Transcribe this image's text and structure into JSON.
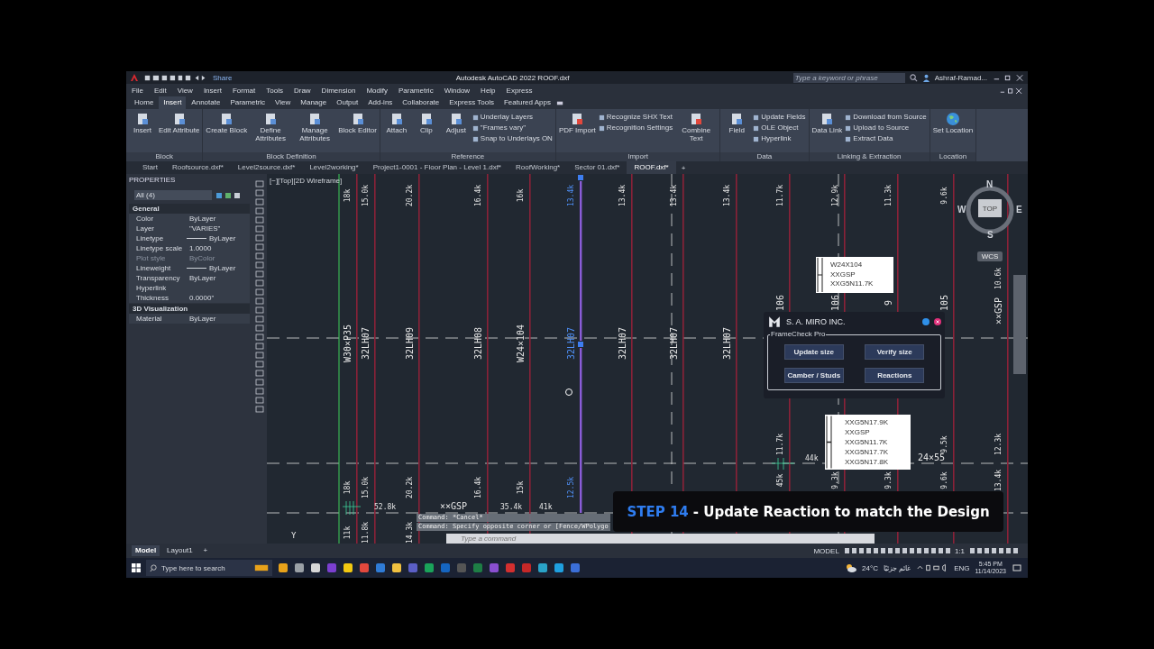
{
  "title_bar": {
    "share": "Share",
    "title": "Autodesk AutoCAD 2022   ROOF.dxf",
    "search": {
      "placeholder": "Type a keyword or phrase"
    },
    "user": "Ashraf-Ramad..."
  },
  "menu": [
    "File",
    "Edit",
    "View",
    "Insert",
    "Format",
    "Tools",
    "Draw",
    "Dimension",
    "Modify",
    "Parametric",
    "Window",
    "Help",
    "Express"
  ],
  "ribbon_tabs": [
    {
      "label": "Home",
      "selected": false
    },
    {
      "label": "Insert",
      "selected": true
    },
    {
      "label": "Annotate",
      "selected": false
    },
    {
      "label": "Parametric",
      "selected": false
    },
    {
      "label": "View",
      "selected": false
    },
    {
      "label": "Manage",
      "selected": false
    },
    {
      "label": "Output",
      "selected": false
    },
    {
      "label": "Add-ins",
      "selected": false
    },
    {
      "label": "Collaborate",
      "selected": false
    },
    {
      "label": "Express Tools",
      "selected": false
    },
    {
      "label": "Featured Apps",
      "selected": false
    }
  ],
  "ribbon_panels": [
    {
      "title": "Block",
      "items": [
        {
          "kind": "large",
          "label": "Insert"
        },
        {
          "kind": "large",
          "label": "Edit Attribute"
        }
      ]
    },
    {
      "title": "Block Definition",
      "items": [
        {
          "kind": "large",
          "label": "Create Block"
        },
        {
          "kind": "large",
          "label": "Define Attributes"
        },
        {
          "kind": "large",
          "label": "Manage Attributes"
        },
        {
          "kind": "large",
          "label": "Block Editor"
        }
      ]
    },
    {
      "title": "Reference",
      "items": [
        {
          "kind": "large",
          "label": "Attach"
        },
        {
          "kind": "large",
          "label": "Clip"
        },
        {
          "kind": "large",
          "label": "Adjust"
        },
        {
          "kind": "stack",
          "labels": [
            "Underlay Layers",
            "\"Frames vary\"",
            "Snap to Underlays ON"
          ]
        }
      ]
    },
    {
      "title": "Import",
      "items": [
        {
          "kind": "large",
          "label": "PDF Import"
        },
        {
          "kind": "stack",
          "labels": [
            "Recognize SHX Text",
            "Recognition Settings"
          ]
        },
        {
          "kind": "large",
          "label": "Combine Text"
        }
      ]
    },
    {
      "title": "Data",
      "items": [
        {
          "kind": "large",
          "label": "Field"
        },
        {
          "kind": "stack",
          "labels": [
            "Update Fields",
            "OLE Object",
            "Hyperlink"
          ]
        }
      ]
    },
    {
      "title": "Linking & Extraction",
      "items": [
        {
          "kind": "large",
          "label": "Data Link"
        },
        {
          "kind": "stack",
          "labels": [
            "Download from Source",
            "Upload to Source",
            "Extract  Data"
          ]
        }
      ]
    },
    {
      "title": "Location",
      "items": [
        {
          "kind": "large",
          "label": "Set Location"
        }
      ]
    }
  ],
  "doc_tabs": [
    {
      "label": "Start",
      "selected": false
    },
    {
      "label": "Roofsource.dxf*",
      "selected": false
    },
    {
      "label": "Level2source.dxf*",
      "selected": false
    },
    {
      "label": "Level2working*",
      "selected": false
    },
    {
      "label": "Project1-0001 - Floor Plan - Level 1.dxf*",
      "selected": false
    },
    {
      "label": "RoofWorking*",
      "selected": false
    },
    {
      "label": "Sector 01.dxf*",
      "selected": false
    },
    {
      "label": "ROOF.dxf*",
      "selected": true
    }
  ],
  "new_tab": "+",
  "properties": {
    "title": "PROPERTIES",
    "selection": "All (4)",
    "sections": [
      {
        "title": "General",
        "rows": [
          {
            "name": "Color",
            "value": "ByLayer",
            "kind": "text",
            "disabled": false
          },
          {
            "name": "Layer",
            "value": "\"VARIES\"",
            "kind": "text",
            "disabled": false
          },
          {
            "name": "Linetype",
            "value": "ByLayer",
            "kind": "line",
            "disabled": false
          },
          {
            "name": "Linetype scale",
            "value": "1.0000",
            "kind": "text",
            "disabled": false
          },
          {
            "name": "Plot style",
            "value": "ByColor",
            "kind": "text",
            "disabled": true
          },
          {
            "name": "Lineweight",
            "value": "ByLayer",
            "kind": "line",
            "disabled": false
          },
          {
            "name": "Transparency",
            "value": "ByLayer",
            "kind": "text",
            "disabled": false
          },
          {
            "name": "Hyperlink",
            "kind": "text",
            "disabled": false
          },
          {
            "name": "Thickness",
            "value": "0.0000\"",
            "kind": "text",
            "disabled": false
          }
        ]
      },
      {
        "title": "3D Visualization",
        "rows": [
          {
            "name": "Material",
            "value": "ByLayer",
            "kind": "text",
            "disabled": false
          }
        ]
      }
    ]
  },
  "drawing": {
    "viewport_label": "[−][Top][2D Wireframe]",
    "members": [
      {
        "top": "18k",
        "mid": "W30×P35",
        "bottom": "18k",
        "base": "11k",
        "selected": false
      },
      {
        "top": "15.0k",
        "mid": "32LH07",
        "bottom": "15.0k",
        "base": "11.8k",
        "selected": false
      },
      {
        "top": "20.2k",
        "mid": "32LH09",
        "bottom": "20.2k",
        "base": "14.3k",
        "selected": false
      },
      {
        "top": "16.4k",
        "mid": "32LH08",
        "bottom": "16.4k",
        "selected": false
      },
      {
        "top": "16k",
        "mid": "W24×104",
        "bottom": "15k",
        "selected": false
      },
      {
        "top": "13.4k",
        "mid": "32LH07",
        "bottom": "12.5k",
        "selected": true
      },
      {
        "top": "13.4k",
        "mid": "32LH07",
        "selected": false
      },
      {
        "top": "13.4k",
        "mid": "32LH07",
        "selected": false
      },
      {
        "top": "13.4k",
        "mid": "32LH07",
        "selected": false
      },
      {
        "top": "11.7k",
        "mid": "106",
        "bottom": "11.7k",
        "base": "45k",
        "selected": false
      },
      {
        "top": "12.9k",
        "mid": "106",
        "base": "9.3k",
        "selected": false
      },
      {
        "top": "11.3k",
        "mid": "9",
        "base": "9.3k",
        "selected": false
      },
      {
        "top": "9.6k",
        "mid": "105",
        "bottom": "9.5k",
        "base": "9.6k",
        "selected": false
      },
      {
        "top": "10.6k",
        "mid": "××GSP",
        "bottom": "12.3k",
        "base": "13.4k",
        "selected": false
      }
    ],
    "annotations": [
      "52.8k",
      "××GSP",
      "35.4k",
      "41k",
      "44k",
      "24×55"
    ],
    "tags": [
      {
        "lines": [
          "W24X104",
          "XXGSP",
          "XXG5N11.7K"
        ]
      },
      {
        "lines": [
          "XXG5N17.9K",
          "XXGSP",
          "XXG5N11.7K",
          "XXG5N17.7K",
          "XXG5N17.8K"
        ]
      }
    ],
    "ucs_label": "Y",
    "command_history": [
      "Command: *Cancel*",
      "Command: Specify opposite corner or [Fence/WPolygo"
    ],
    "command_input": {
      "placeholder": "Type a command"
    },
    "viewcube": {
      "north": "N",
      "south": "S",
      "east": "E",
      "west": "W",
      "face": "TOP",
      "wcs": "WCS"
    }
  },
  "dialog": {
    "company": "S. A. MIRO INC.",
    "group": "FrameCheck Pro",
    "buttons": [
      "Update size",
      "Verify size",
      "Camber / Studs",
      "Reactions"
    ]
  },
  "banner": {
    "step": "STEP 14",
    "caption": "- Update Reaction to match the Design"
  },
  "layout_tabs": [
    {
      "label": "Model",
      "selected": true
    },
    {
      "label": "Layout1",
      "selected": false
    }
  ],
  "status": {
    "model": "MODEL",
    "scale": "1:1"
  },
  "taskbar": {
    "search": {
      "placeholder": "Type here to search"
    },
    "temperature": "24°C",
    "weather": "غائم جزئيًا",
    "language": "ENG",
    "time": "5:45 PM",
    "date": "11/14/2023"
  }
}
